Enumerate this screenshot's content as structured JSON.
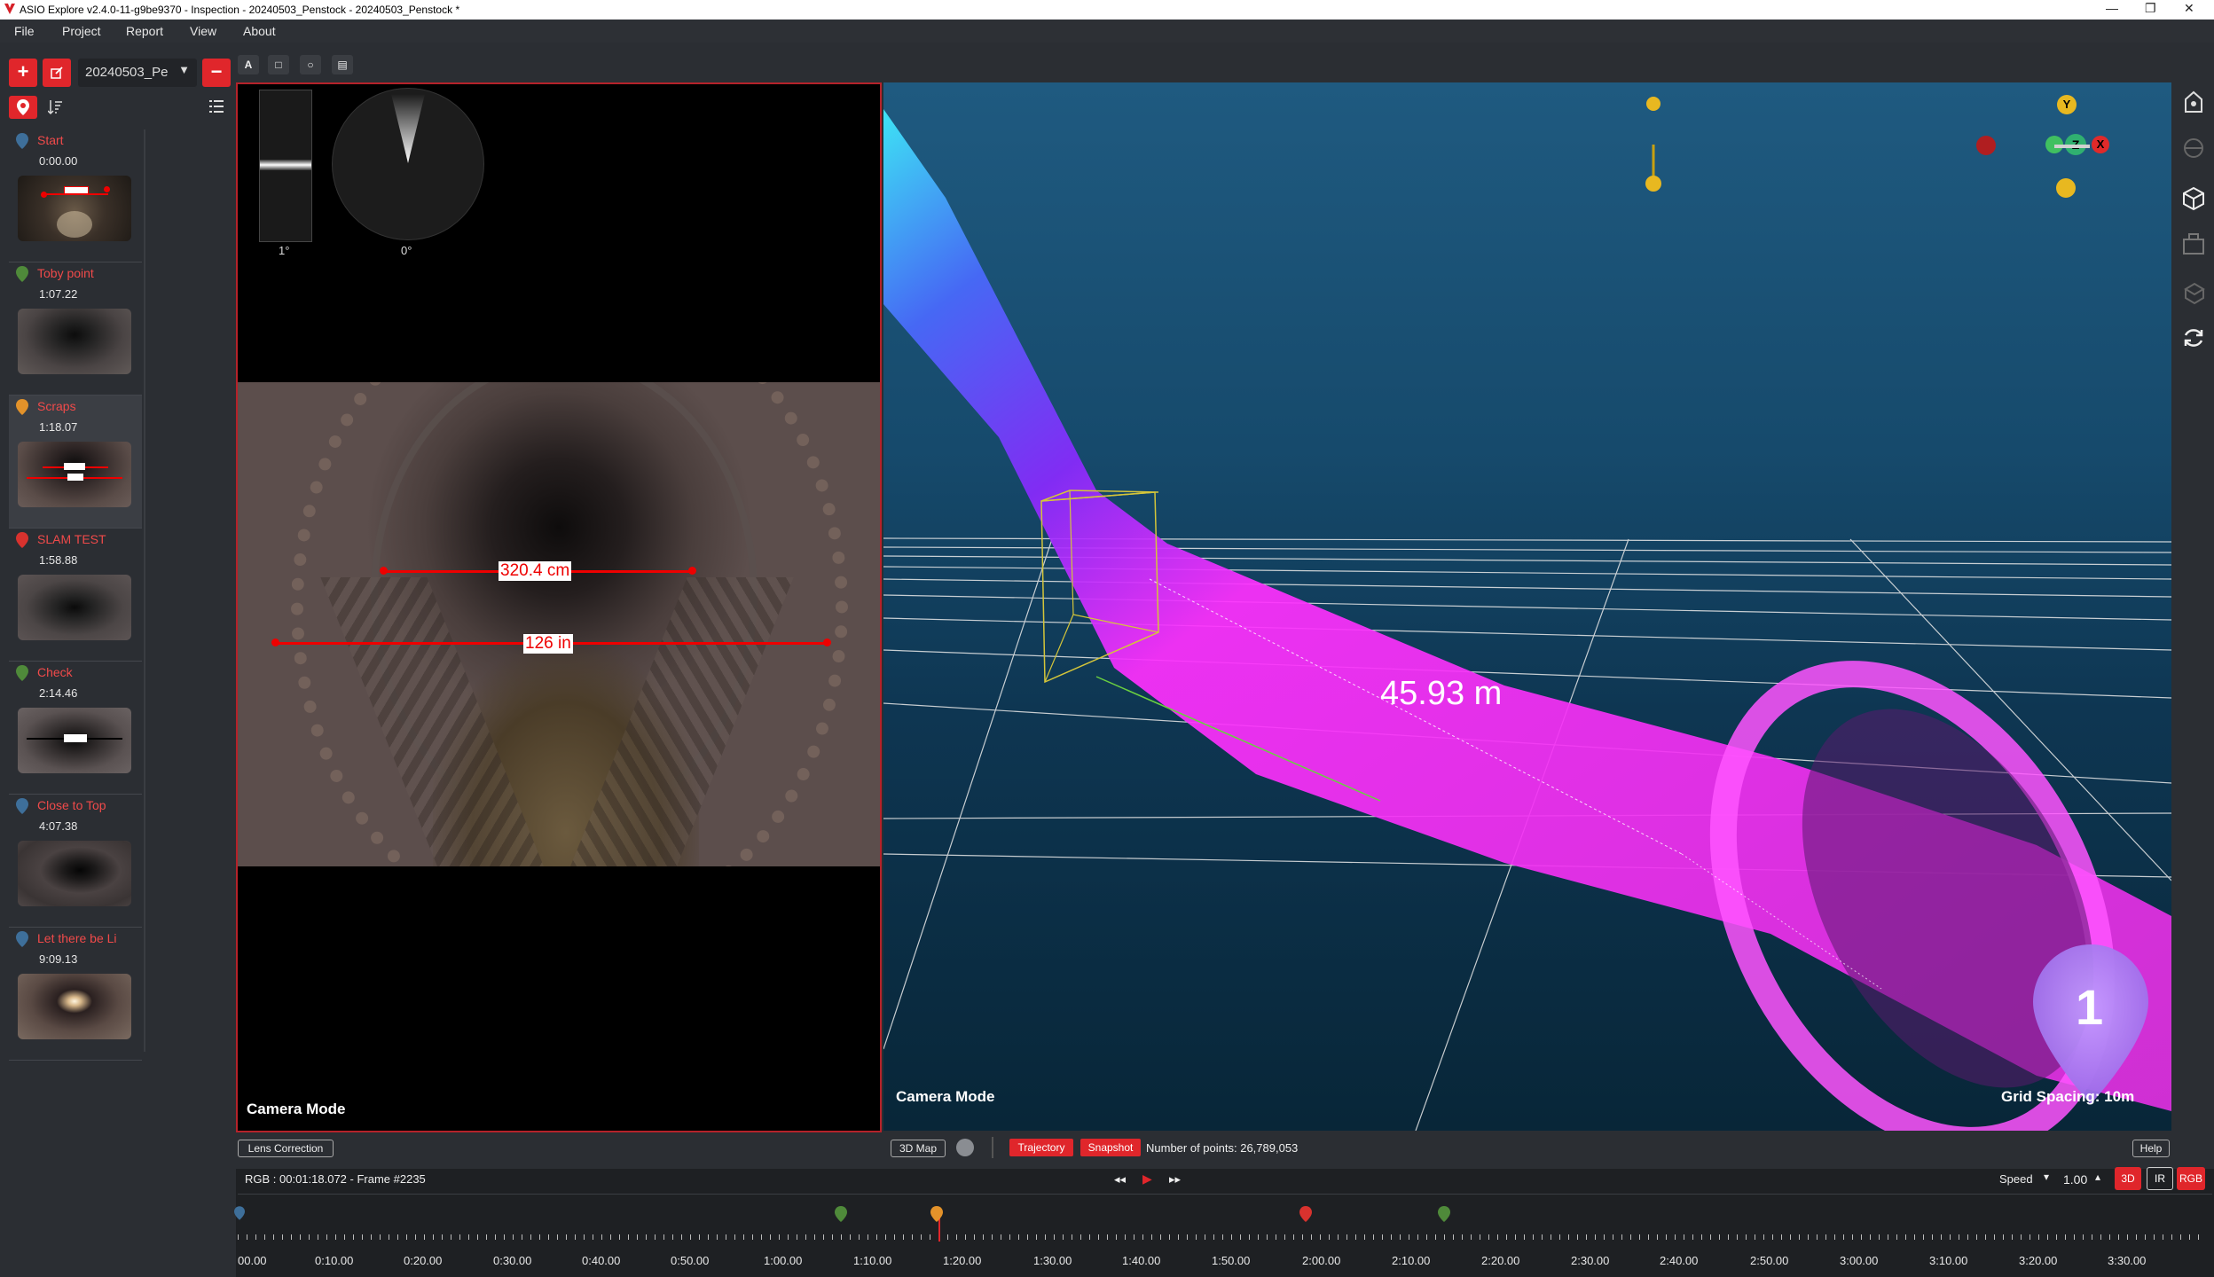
{
  "window": {
    "title": "ASIO Explore v2.4.0-11-g9be9370 - Inspection - 20240503_Penstock - 20240503_Penstock *",
    "minimize": "—",
    "maximize": "❐",
    "close": "✕"
  },
  "menu": [
    "File",
    "Project",
    "Report",
    "View",
    "About"
  ],
  "toolbar": {
    "add_label": "+",
    "remove_label": "−",
    "project_value": "20240503_Pe",
    "draw_tools": [
      "A",
      "□",
      "○",
      "▤"
    ]
  },
  "snapshots": [
    {
      "name": "Start",
      "time": "0:00.00",
      "pin_color": "#3e6f9a",
      "pin_num": "1"
    },
    {
      "name": "Toby point",
      "time": "1:07.22",
      "pin_color": "#4f8a3a",
      "pin_num": "7"
    },
    {
      "name": "Scraps",
      "time": "1:18.07",
      "pin_color": "#e3922a",
      "pin_num": "2"
    },
    {
      "name": "SLAM TEST",
      "time": "1:58.88",
      "pin_color": "#d8322e",
      "pin_num": "6"
    },
    {
      "name": "Check",
      "time": "2:14.46",
      "pin_color": "#4f8a3a",
      "pin_num": "5"
    },
    {
      "name": "Close to Top",
      "time": "4:07.38",
      "pin_color": "#3e6f9a",
      "pin_num": "3"
    },
    {
      "name": "Let there be Li",
      "time": "9:09.13",
      "pin_color": "#3e6f9a",
      "pin_num": "4"
    }
  ],
  "camera": {
    "tilt_label": "1°",
    "roll_label": "0°",
    "measure1": "320.4 cm",
    "measure2": "126 in",
    "mode_label": "Camera Mode",
    "lens_button": "Lens Correction"
  },
  "pointcloud": {
    "distance_label": "45.93 m",
    "mode_label": "Camera Mode",
    "grid_label": "Grid Spacing: 10m",
    "marker_num": "1",
    "axes": {
      "y": "Y",
      "z": "Z",
      "x": "X"
    }
  },
  "viewbar": {
    "map_button": "3D Map",
    "trajectory_button": "Trajectory",
    "snapshot_button": "Snapshot",
    "points_text": "Number of points: 26,789,053",
    "help_button": "Help"
  },
  "playback": {
    "frame_text": "RGB : 00:01:18.072 - Frame #2235",
    "rewind": "◂◂",
    "play": "▶",
    "forward": "▸▸",
    "speed_label": "Speed",
    "speed_value": "1.00",
    "mode_3d": "3D",
    "mode_ir": "IR",
    "mode_rgb": "RGB"
  },
  "timeline": {
    "ticks": [
      "00.00",
      "0:10.00",
      "0:20.00",
      "0:30.00",
      "0:40.00",
      "0:50.00",
      "1:00.00",
      "1:10.00",
      "1:20.00",
      "1:30.00",
      "1:40.00",
      "1:50.00",
      "2:00.00",
      "2:10.00",
      "2:20.00",
      "2:30.00",
      "2:40.00",
      "2:50.00",
      "3:00.00",
      "3:10.00",
      "3:20.00",
      "3:30.00"
    ],
    "markers": [
      {
        "num": "1",
        "color": "#3e6f9a"
      },
      {
        "num": "7",
        "color": "#4f8a3a"
      },
      {
        "num": "2",
        "color": "#e3922a"
      },
      {
        "num": "6",
        "color": "#d8322e"
      },
      {
        "num": "5",
        "color": "#4f8a3a"
      }
    ]
  },
  "accent_color": "#e0262b"
}
